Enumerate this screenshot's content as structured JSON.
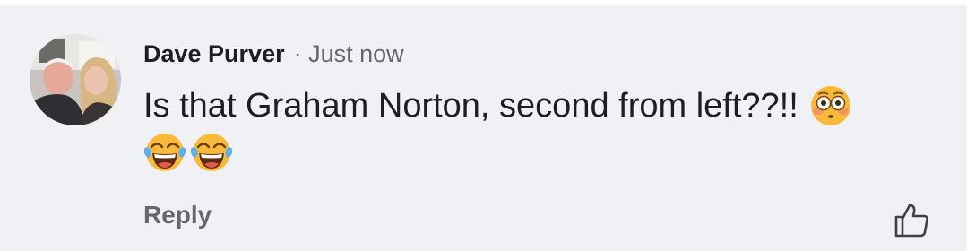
{
  "comment": {
    "author": "Dave Purver",
    "separator": "·",
    "timestamp": "Just now",
    "text": "Is that Graham Norton, second from left??!!",
    "emojis_line1": [
      "flushed-face"
    ],
    "emojis_line2": [
      "face-with-tears-of-joy",
      "face-with-tears-of-joy"
    ],
    "actions": {
      "reply_label": "Reply",
      "like_icon": "thumbs-up-outline-icon"
    }
  },
  "colors": {
    "background": "#f0f1f5",
    "author_text": "#1c1e21",
    "secondary_text": "#65676b"
  }
}
